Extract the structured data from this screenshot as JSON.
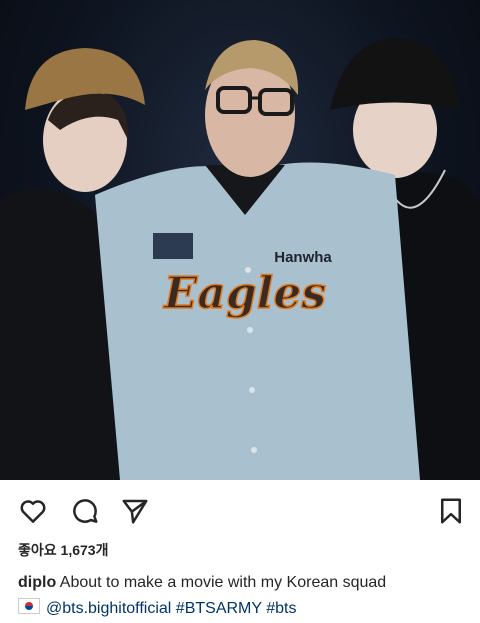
{
  "post": {
    "likes_text": "좋아요 1,673개",
    "caption": {
      "username": "diplo",
      "text": "About to make a movie with my Korean squad",
      "flag_icon": "korea-flag-icon",
      "mention": "@bts.bighitofficial",
      "hashtags": [
        "#BTSARMY",
        "#bts"
      ]
    },
    "photo": {
      "jersey_team": "Eagles",
      "jersey_sponsor": "Hanwha"
    }
  },
  "actions": {
    "like_icon": "heart-icon",
    "comment_icon": "comment-icon",
    "share_icon": "send-icon",
    "save_icon": "bookmark-icon"
  }
}
